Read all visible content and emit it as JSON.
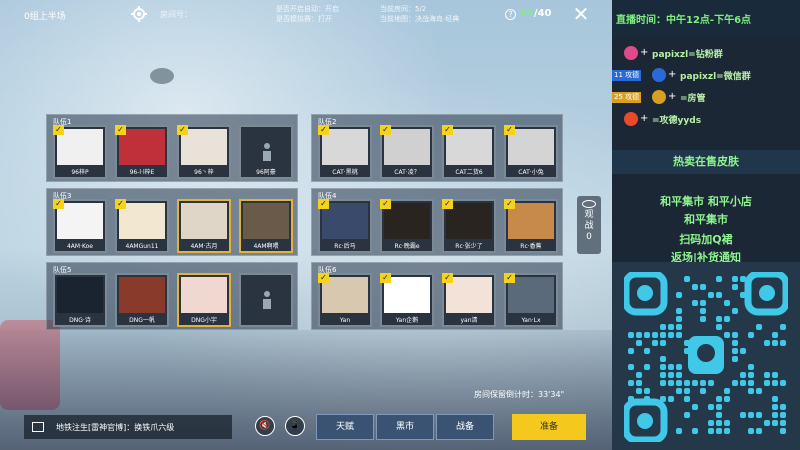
{
  "topbar": {
    "room_name": "0组上半场",
    "room_id": "房间号：",
    "settings_line1": "是否开启自动：开启",
    "settings_line2": "是否模拟赛：打开",
    "mode_line1": "当前房间：5/2",
    "mode_line2": "当前地图：决战海岛·经典",
    "help": "?",
    "count_current": "27",
    "count_max": "/40",
    "close": "✕"
  },
  "teams": [
    {
      "label": "队伍1",
      "slots": [
        {
          "name": "96梓P",
          "ready": true,
          "gold": false,
          "color": "#f0f0f0"
        },
        {
          "name": "96-l·l梓E",
          "ready": true,
          "gold": false,
          "color": "#c0303a"
        },
        {
          "name": "96丶梓",
          "ready": true,
          "gold": false,
          "color": "#e8e2d8"
        },
        {
          "name": "96阿豪",
          "ready": false,
          "gold": false,
          "empty": true
        }
      ]
    },
    {
      "label": "队伍2",
      "slots": [
        {
          "name": "CAT·黑桃",
          "ready": true,
          "gold": false,
          "color": "#d8d8d8"
        },
        {
          "name": "CAT·凌？",
          "ready": true,
          "gold": false,
          "color": "#d0d0d0"
        },
        {
          "name": "CAT二货6",
          "ready": true,
          "gold": false,
          "color": "#d8d8d8"
        },
        {
          "name": "CAT·小兔",
          "ready": true,
          "gold": false,
          "color": "#d4d4d4"
        }
      ]
    },
    {
      "label": "队伍3",
      "slots": [
        {
          "name": "4AM·Koe",
          "ready": true,
          "gold": false,
          "color": "#f4f4f4"
        },
        {
          "name": "4AMGun11",
          "ready": true,
          "gold": false,
          "color": "#f2e8d0"
        },
        {
          "name": "4AM·古月",
          "ready": false,
          "gold": true,
          "color": "#e0d6c8"
        },
        {
          "name": "4AM啊喂",
          "ready": false,
          "gold": true,
          "color": "#6a5a4a"
        }
      ]
    },
    {
      "label": "队伍4",
      "slots": [
        {
          "name": "Rc·后马",
          "ready": true,
          "gold": false,
          "color": "#3a4a6a"
        },
        {
          "name": "Rc·晚霸e",
          "ready": true,
          "gold": false,
          "color": "#2a2420"
        },
        {
          "name": "Rc·张少了",
          "ready": true,
          "gold": false,
          "color": "#2a2420"
        },
        {
          "name": "Rc·香蕉",
          "ready": true,
          "gold": false,
          "color": "#c88a4a"
        }
      ]
    },
    {
      "label": "队伍5",
      "slots": [
        {
          "name": "DNG·诗",
          "ready": false,
          "gold": false,
          "color": "#1a2330"
        },
        {
          "name": "DNG一帆",
          "ready": false,
          "gold": false,
          "color": "#8a3a2a"
        },
        {
          "name": "DNG小宇",
          "ready": false,
          "gold": true,
          "color": "#f0d8d0"
        },
        {
          "name": "",
          "ready": false,
          "gold": false,
          "empty": true
        }
      ]
    },
    {
      "label": "队伍6",
      "slots": [
        {
          "name": "Yan",
          "ready": true,
          "gold": false,
          "color": "#d8c8b0"
        },
        {
          "name": "Yan企鹅",
          "ready": true,
          "gold": false,
          "color": "#ffffff"
        },
        {
          "name": "yan清",
          "ready": true,
          "gold": false,
          "color": "#f2e2d8"
        },
        {
          "name": "Yan·Lx",
          "ready": true,
          "gold": false,
          "color": "#5a6a7a"
        }
      ]
    }
  ],
  "spectate": {
    "label": "观战",
    "count": "0"
  },
  "footer": {
    "timer": "房间保留倒计时：33'34\"",
    "chat": "地铁注生[雷神官博]：换铁爪六级",
    "mic": "🔇",
    "phone": "📱",
    "btn_talent": "天赋",
    "btn_market": "黑市",
    "btn_outfit": "战备",
    "btn_ready": "准备"
  },
  "side": {
    "time": "直播时间：中午12点-下午6点",
    "contacts": [
      {
        "text": "papixzl=钻粉群",
        "tag": "",
        "icon_color": "#e04a8a"
      },
      {
        "text": "papixzl=微信群",
        "tag": "11 攻德",
        "icon_color": "#2a6ad8"
      },
      {
        "text": "=房管",
        "tag": "25 攻德",
        "icon_color": "#d8a020"
      },
      {
        "text": "=攻德yyds",
        "tag": "",
        "icon_color": "#e84a2a"
      }
    ],
    "line1": "热卖在售皮肤",
    "line2": "和平集市  和平小店",
    "line3": "和平集市",
    "line4": "扫码加Q裙",
    "line5": "返场|补货通知"
  },
  "colors": {
    "accent_green": "#7cf07c",
    "ready_yellow": "#f4c81d",
    "check_yellow": "#f5d21c",
    "qr_color": "#3fc8e8"
  }
}
